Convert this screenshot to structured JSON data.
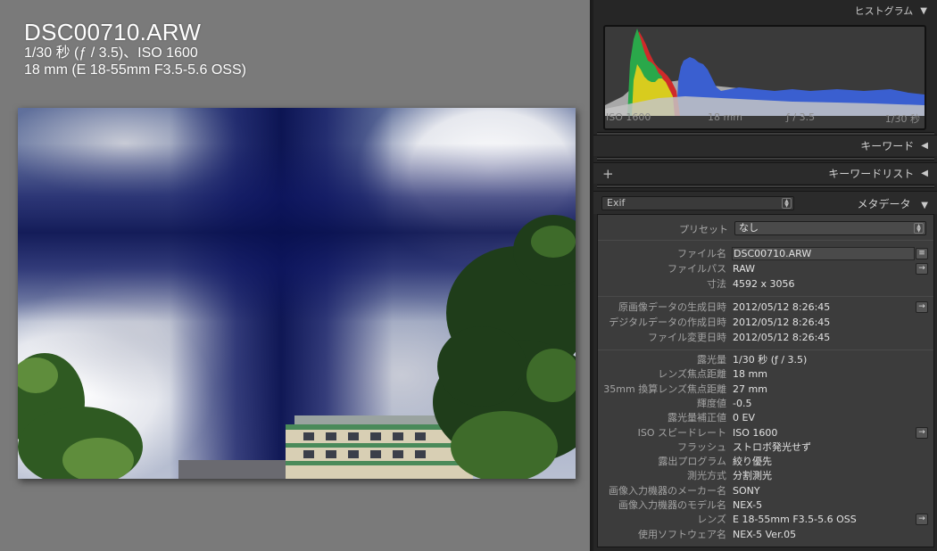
{
  "viewer": {
    "filename": "DSC00710.ARW",
    "line1": "1/30 秒 (ƒ / 3.5)、ISO 1600",
    "line2": "18 mm (E 18-55mm F3.5-5.6 OSS)"
  },
  "histogram": {
    "title": "ヒストグラム",
    "iso": "ISO 1600",
    "focal": "18 mm",
    "aperture": "ƒ / 3.5",
    "shutter": "1/30 秒"
  },
  "keywords": {
    "title": "キーワード"
  },
  "keyword_list": {
    "title": "キーワードリスト",
    "add": "+"
  },
  "metadata": {
    "title": "メタデータ",
    "view_select": "Exif",
    "preset_label": "プリセット",
    "preset_value": "なし",
    "group1": [
      {
        "label": "ファイル名",
        "value": "DSC00710.ARW",
        "button": "list"
      },
      {
        "label": "ファイルパス",
        "value": "RAW",
        "button": "arrow"
      },
      {
        "label": "寸法",
        "value": "4592 x 3056",
        "button": ""
      }
    ],
    "group2": [
      {
        "label": "原画像データの生成日時",
        "value": "2012/05/12 8:26:45",
        "button": "arrow"
      },
      {
        "label": "デジタルデータの作成日時",
        "value": "2012/05/12 8:26:45",
        "button": ""
      },
      {
        "label": "ファイル変更日時",
        "value": "2012/05/12 8:26:45",
        "button": ""
      }
    ],
    "group3": [
      {
        "label": "露光量",
        "value": "1/30 秒 (ƒ / 3.5)",
        "button": ""
      },
      {
        "label": "レンズ焦点距離",
        "value": "18 mm",
        "button": ""
      },
      {
        "label": "35mm 換算レンズ焦点距離",
        "value": "27 mm",
        "button": ""
      },
      {
        "label": "輝度値",
        "value": "-0.5",
        "button": ""
      },
      {
        "label": "露光量補正値",
        "value": "0 EV",
        "button": ""
      },
      {
        "label": "ISO スピードレート",
        "value": "ISO 1600",
        "button": "arrow"
      },
      {
        "label": "フラッシュ",
        "value": "ストロボ発光せず",
        "button": ""
      },
      {
        "label": "露出プログラム",
        "value": "絞り優先",
        "button": ""
      },
      {
        "label": "測光方式",
        "value": "分割測光",
        "button": ""
      },
      {
        "label": "画像入力機器のメーカー名",
        "value": "SONY",
        "button": ""
      },
      {
        "label": "画像入力機器のモデル名",
        "value": "NEX-5",
        "button": ""
      },
      {
        "label": "レンズ",
        "value": "E 18-55mm F3.5-5.6 OSS",
        "button": "arrow"
      },
      {
        "label": "使用ソフトウェア名",
        "value": "NEX-5 Ver.05",
        "button": ""
      }
    ]
  },
  "icons": {
    "collapse": "triangle-down-icon",
    "expand": "triangle-left-icon",
    "arrow": "arrow-right-icon",
    "list": "list-icon"
  }
}
